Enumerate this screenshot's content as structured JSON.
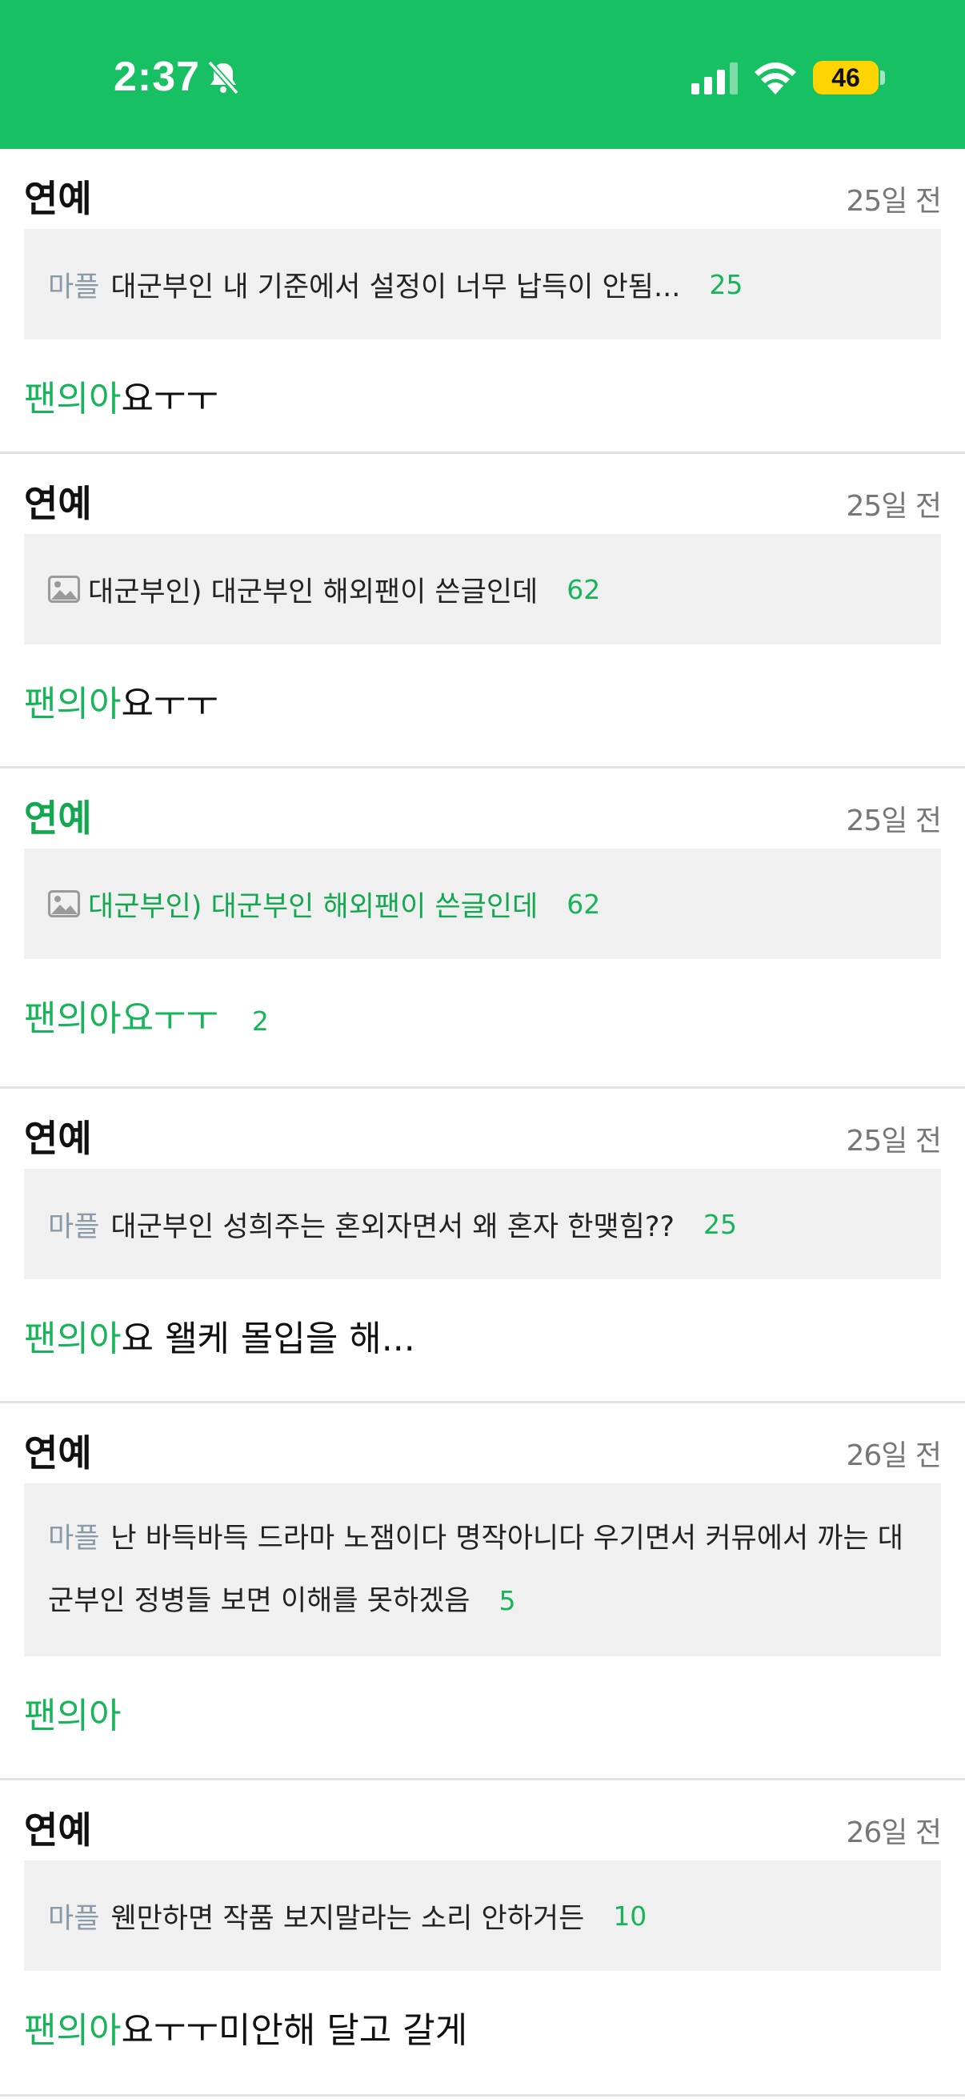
{
  "status_bar": {
    "time": "2:37",
    "battery": "46",
    "colors": {
      "background": "#17c063",
      "battery": "#ffd400"
    }
  },
  "entries": [
    {
      "category": "연예",
      "time": "25일 전",
      "post": {
        "tag": "마플",
        "title": "대군부인 내 기준에서 설정이 너무 납득이 안됨...",
        "count": "25"
      },
      "comment": {
        "nick": "팬의아",
        "text": "요ㅜㅜ",
        "replies": ""
      }
    },
    {
      "category": "연예",
      "time": "25일 전",
      "post": {
        "icon": "image-icon",
        "title": "대군부인) 대군부인 해외팬이 쓴글인데",
        "count": "62"
      },
      "comment": {
        "nick": "팬의아",
        "text": "요ㅜㅜ",
        "replies": ""
      }
    },
    {
      "category": "연예",
      "time": "25일 전",
      "post": {
        "icon": "image-icon",
        "title": "대군부인) 대군부인 해외팬이 쓴글인데",
        "count": "62"
      },
      "comment": {
        "nick": "팬의아요ㅜㅜ",
        "text": "",
        "replies": "2"
      }
    },
    {
      "category": "연예",
      "time": "25일 전",
      "post": {
        "tag": "마플",
        "title": "대군부인 성희주는 혼외자면서 왜 혼자 한맺힘??",
        "count": "25"
      },
      "comment": {
        "nick": "팬의아",
        "text": "요 왤케 몰입을 해...",
        "replies": ""
      }
    },
    {
      "category": "연예",
      "time": "26일 전",
      "post": {
        "tag": "마플",
        "title": "난 바득바득 드라마 노잼이다 명작아니다 우기면서 커뮤에서 까는 대군부인 정병들 보면 이해를 못하겠음",
        "count": "5"
      },
      "comment": {
        "nick": "팬의아",
        "text": "",
        "replies": ""
      }
    },
    {
      "category": "연예",
      "time": "26일 전",
      "post": {
        "tag": "마플",
        "title": "웬만하면 작품 보지말라는 소리 안하거든",
        "count": "10"
      },
      "comment": {
        "nick": "팬의아",
        "text": "요ㅜㅜ미안해 달고 갈게",
        "replies": ""
      }
    }
  ]
}
